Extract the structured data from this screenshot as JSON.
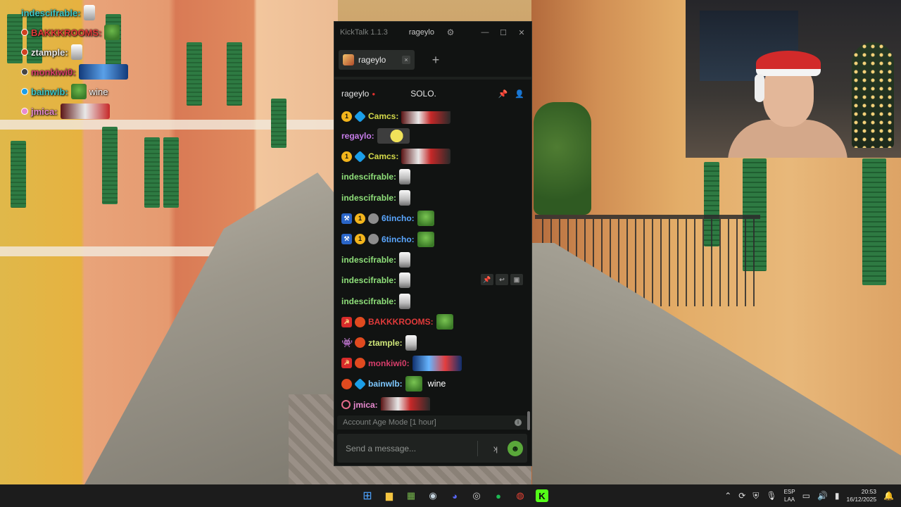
{
  "overlay_chat": [
    {
      "user": "indescifrable:",
      "color": "#3cc8c8",
      "emote": "small"
    },
    {
      "user": "BAKKKROOMS:",
      "color": "#e03a3a",
      "emote": "pepe"
    },
    {
      "user": "ztample:",
      "color": "#e8e8e8",
      "emote": "small"
    },
    {
      "user": "monkiwi0:",
      "color": "#d63d6a",
      "emote": "wide"
    },
    {
      "user": "bainwlb:",
      "color": "#3cc8c8",
      "emote": "pepe",
      "text": "wine"
    },
    {
      "user": "jmica:",
      "color": "#e88ad0",
      "emote": "wide"
    }
  ],
  "kicktalk": {
    "app_title": "KickTalk 1.1.3",
    "account": "rageylo",
    "tab": {
      "label": "rageylo",
      "close": "×"
    },
    "add_tab": "+",
    "header": {
      "channel": "rageylo",
      "live_dot": "●",
      "title": "SOLO."
    },
    "messages": [
      {
        "badges": [
          "sub",
          "cube"
        ],
        "user": "Camcs:",
        "color": "#d4d94a",
        "emote": "wide",
        "first": true
      },
      {
        "badges": [],
        "user": "regaylo:",
        "color": "#c77dea",
        "emote": "cheese"
      },
      {
        "badges": [
          "sub",
          "cube"
        ],
        "user": "Camcs:",
        "color": "#d4d94a",
        "emote": "wide"
      },
      {
        "badges": [],
        "user": "indescifrable:",
        "color": "#8fe07a",
        "emote": "cup"
      },
      {
        "badges": [],
        "user": "indescifrable:",
        "color": "#8fe07a",
        "emote": "cup"
      },
      {
        "badges": [
          "mod",
          "sub",
          "gray"
        ],
        "user": "6tincho:",
        "color": "#5aa6ff",
        "emote": "pepe"
      },
      {
        "badges": [
          "mod",
          "sub",
          "gray"
        ],
        "user": "6tincho:",
        "color": "#5aa6ff",
        "emote": "pepe"
      },
      {
        "badges": [],
        "user": "indescifrable:",
        "color": "#8fe07a",
        "emote": "cup"
      },
      {
        "badges": [],
        "user": "indescifrable:",
        "color": "#8fe07a",
        "emote": "cup",
        "hovered": true
      },
      {
        "badges": [],
        "user": "indescifrable:",
        "color": "#8fe07a",
        "emote": "cup"
      },
      {
        "badges": [
          "clown",
          "gift"
        ],
        "user": "BAKKKROOMS:",
        "color": "#e03a3a",
        "emote": "pepe"
      },
      {
        "badges": [
          "alien",
          "gift"
        ],
        "user": "ztample:",
        "color": "#cfe67a",
        "emote": "cup"
      },
      {
        "badges": [
          "clown",
          "gift"
        ],
        "user": "monkiwi0:",
        "color": "#d63d6a",
        "emote": "wide2"
      },
      {
        "badges": [
          "gift",
          "cube"
        ],
        "user": "bainwlb:",
        "color": "#7ec8ff",
        "emote": "pepe",
        "text": "wine"
      },
      {
        "badges": [
          "target"
        ],
        "user": "jmica:",
        "color": "#e88ad0",
        "emote": "wide"
      }
    ],
    "mode_label": "Account Age Mode [1 hour]",
    "input_placeholder": "Send a message..."
  },
  "taskbar": {
    "language": "ESP",
    "layout": "LAA",
    "time": "20:53",
    "date": "16/12/2025"
  }
}
